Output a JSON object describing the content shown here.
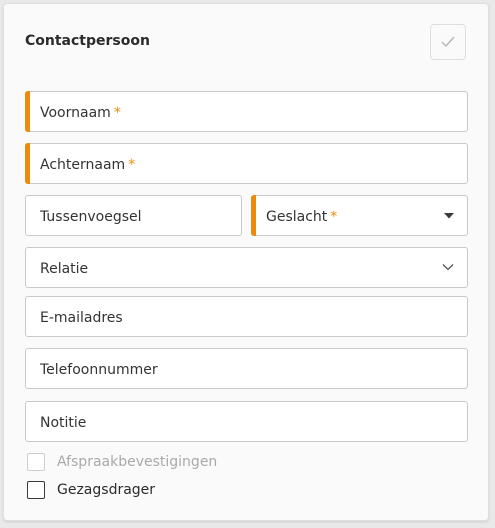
{
  "form": {
    "title": "Contactpersoon",
    "confirm_icon": "check-icon",
    "fields": {
      "voornaam": {
        "label": "Voornaam",
        "required": true,
        "value": ""
      },
      "achternaam": {
        "label": "Achternaam",
        "required": true,
        "value": ""
      },
      "tussenvoegsel": {
        "label": "Tussenvoegsel",
        "required": false,
        "value": ""
      },
      "geslacht": {
        "label": "Geslacht",
        "required": true,
        "value": "",
        "icon": "caret-down-icon"
      },
      "relatie": {
        "label": "Relatie",
        "required": false,
        "value": "",
        "icon": "chevron-down-icon"
      },
      "emailadres": {
        "label": "E-mailadres",
        "required": false,
        "value": ""
      },
      "telefoonnummer": {
        "label": "Telefoonnummer",
        "required": false,
        "value": ""
      },
      "notitie": {
        "label": "Notitie",
        "required": false,
        "value": ""
      }
    },
    "required_marker": "*",
    "checkboxes": {
      "afspraakbevestigingen": {
        "label": "Afspraakbevestigingen",
        "checked": false,
        "disabled": true
      },
      "gezagsdrager": {
        "label": "Gezagsdrager",
        "checked": false,
        "disabled": false
      }
    }
  },
  "colors": {
    "required_accent": "#ec8b0b",
    "border": "#c9c9c9",
    "text": "#333333",
    "disabled_text": "#a9a9a9"
  }
}
